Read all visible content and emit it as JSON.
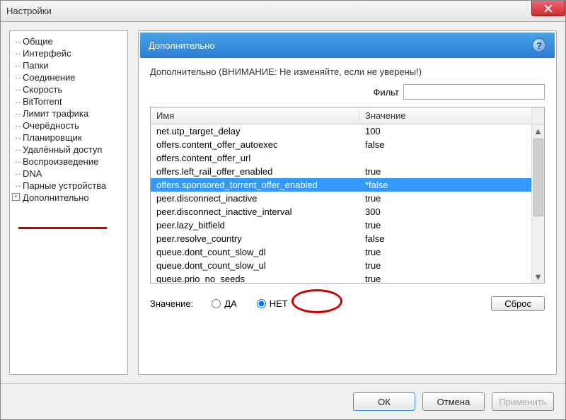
{
  "window": {
    "title": "Настройки"
  },
  "sidebar": {
    "items": [
      {
        "label": "Общие"
      },
      {
        "label": "Интерфейс"
      },
      {
        "label": "Папки"
      },
      {
        "label": "Соединение"
      },
      {
        "label": "Скорость"
      },
      {
        "label": "BitTorrent"
      },
      {
        "label": "Лимит трафика"
      },
      {
        "label": "Очерёдность"
      },
      {
        "label": "Планировщик"
      },
      {
        "label": "Удалённый доступ"
      },
      {
        "label": "Воспроизведение"
      },
      {
        "label": "DNA"
      },
      {
        "label": "Парные устройства"
      },
      {
        "label": "Дополнительно"
      }
    ]
  },
  "panel": {
    "title": "Дополнительно",
    "warning": "Дополнительно (ВНИМАНИЕ: Не изменяйте, если не уверены!)",
    "filter_label": "Фильт"
  },
  "table": {
    "cols": {
      "name": "Имя",
      "value": "Значение"
    },
    "rows": [
      {
        "name": "net.utp_target_delay",
        "value": "100",
        "sel": false
      },
      {
        "name": "offers.content_offer_autoexec",
        "value": "false",
        "sel": false
      },
      {
        "name": "offers.content_offer_url",
        "value": "",
        "sel": false
      },
      {
        "name": "offers.left_rail_offer_enabled",
        "value": "true",
        "sel": false
      },
      {
        "name": "offers.sponsored_torrent_offer_enabled",
        "value": "*false",
        "sel": true
      },
      {
        "name": "peer.disconnect_inactive",
        "value": "true",
        "sel": false
      },
      {
        "name": "peer.disconnect_inactive_interval",
        "value": "300",
        "sel": false
      },
      {
        "name": "peer.lazy_bitfield",
        "value": "true",
        "sel": false
      },
      {
        "name": "peer.resolve_country",
        "value": "false",
        "sel": false
      },
      {
        "name": "queue.dont_count_slow_dl",
        "value": "true",
        "sel": false
      },
      {
        "name": "queue.dont_count_slow_ul",
        "value": "true",
        "sel": false
      },
      {
        "name": "queue.prio_no_seeds",
        "value": "true",
        "sel": false
      }
    ]
  },
  "value_editor": {
    "label": "Значение:",
    "yes": "ДА",
    "no": "НЕТ",
    "selected": "no",
    "reset": "Сброс"
  },
  "footer": {
    "ok": "ОК",
    "cancel": "Отмена",
    "apply": "Применить"
  }
}
